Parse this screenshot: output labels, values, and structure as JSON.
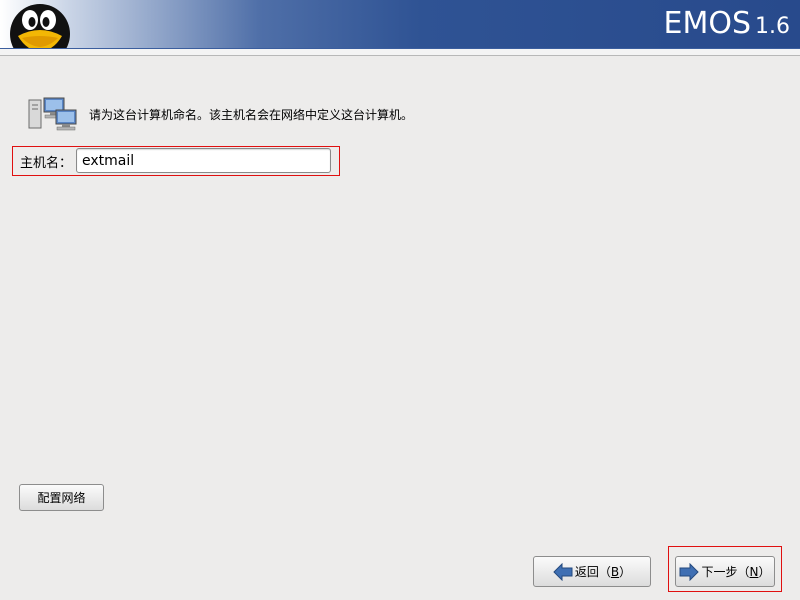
{
  "header": {
    "brand": "EMOS",
    "version": "1.6",
    "logo_icon": "tux-penguin-icon",
    "colors": {
      "banner_dark": "#284a8c",
      "banner_light": "#ffffff"
    }
  },
  "intro": {
    "icon": "network-computers-icon",
    "text": "请为这台计算机命名。该主机名会在网络中定义这台计算机。"
  },
  "hostname": {
    "label": "主机名：",
    "value": "extmail"
  },
  "buttons": {
    "configure_network": "配置网络",
    "back_prefix": "返回（",
    "back_key": "B",
    "back_suffix": "）",
    "next_prefix": "下一步（",
    "next_key": "N",
    "next_suffix": "）"
  },
  "highlight_color": "#e01010"
}
